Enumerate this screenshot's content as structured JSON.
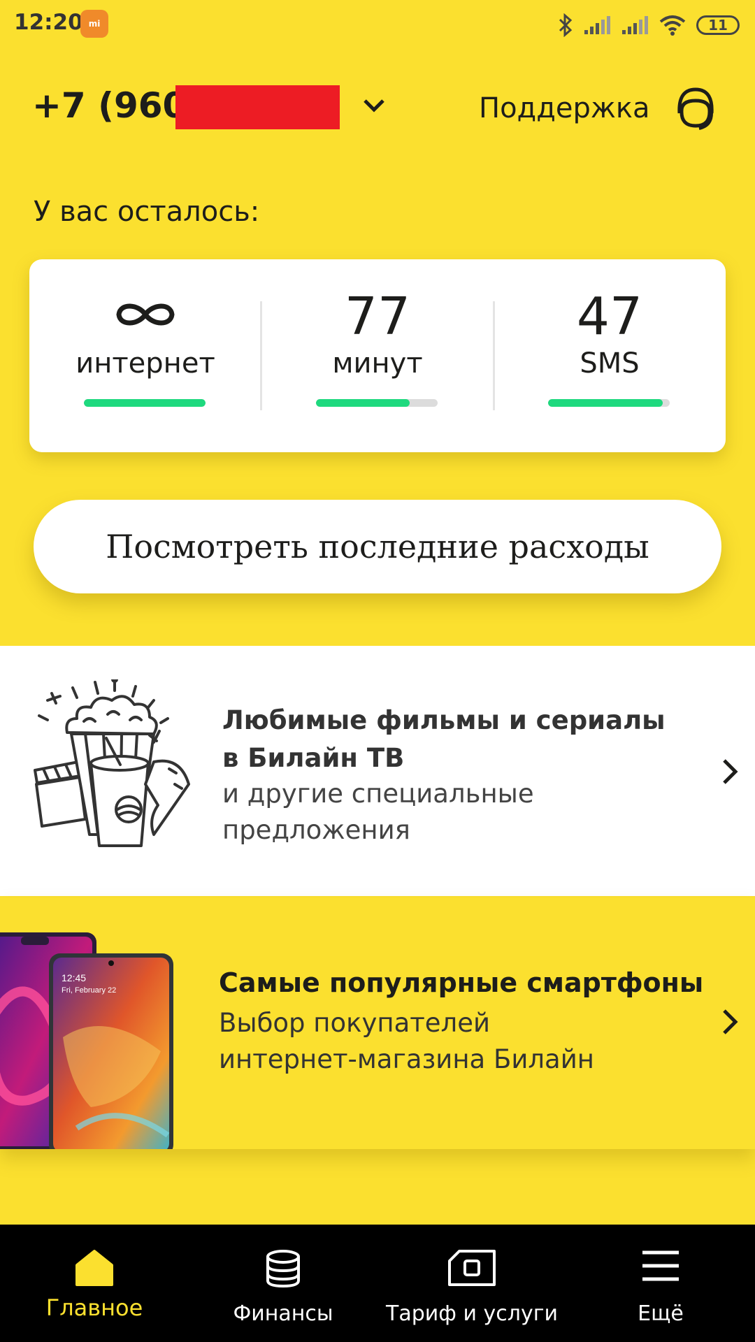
{
  "status_bar": {
    "time": "12:20",
    "app_badge": "mi",
    "battery": "11",
    "icons": [
      "bluetooth-icon",
      "signal-icon",
      "signal-icon",
      "wifi-icon",
      "battery-icon"
    ]
  },
  "header": {
    "phone_number": "+7 (960)",
    "support_label": "Поддержка",
    "icons": [
      "chevron-down-icon",
      "headset-icon"
    ]
  },
  "balance": {
    "label": "У вас осталось:",
    "items": [
      {
        "value": "∞",
        "icon": "infinity-icon",
        "caption": "интернет",
        "progress": 1.0
      },
      {
        "value": "77",
        "caption": "минут",
        "progress": 0.77
      },
      {
        "value": "47",
        "caption": "SMS",
        "progress": 0.94
      }
    ]
  },
  "expenses_button": {
    "label": "Посмотреть последние расходы"
  },
  "promos": [
    {
      "title_lines": [
        "Любимые фильмы и сериалы",
        "в Билайн ТВ"
      ],
      "subtitle_lines": [
        "и другие специальные",
        "предложения"
      ],
      "image": "popcorn-cinema-illustration"
    },
    {
      "title": "Самые популярные смартфоны",
      "subtitle_lines": [
        "Выбор покупателей",
        "интернет-магазина Билайн"
      ],
      "image": "smartphones-image",
      "phone_screen_time": "12:45",
      "phone_screen_date": "Fri, February 22"
    }
  ],
  "bottom_nav": [
    {
      "label": "Главное",
      "icon": "home-icon",
      "active": true
    },
    {
      "label": "Финансы",
      "icon": "coins-icon",
      "active": false
    },
    {
      "label": "Тариф и услуги",
      "icon": "sim-card-icon",
      "active": false
    },
    {
      "label": "Ещё",
      "icon": "menu-icon",
      "active": false
    }
  ],
  "colors": {
    "brand_yellow": "#fbe02f",
    "progress_green": "#1ed97e",
    "nav_background": "#000000",
    "redaction_red": "#ed1c24"
  }
}
